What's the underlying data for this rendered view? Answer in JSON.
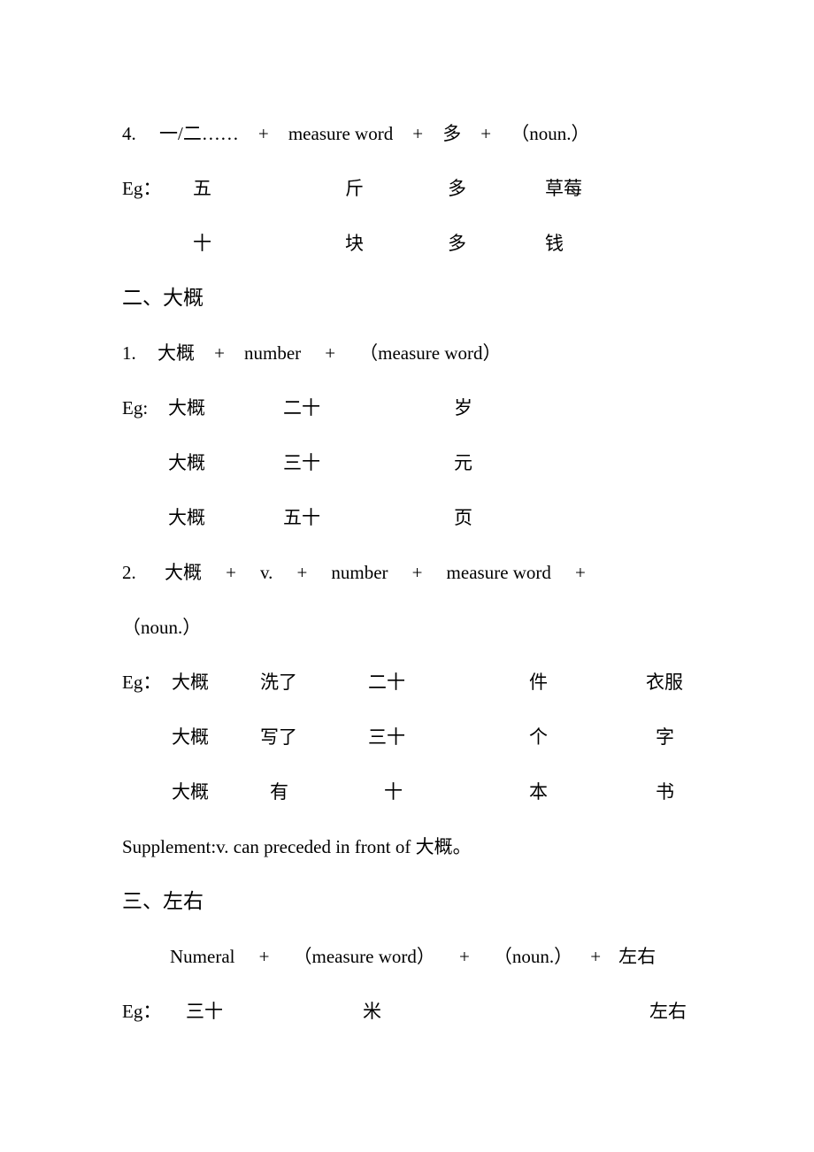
{
  "document": {
    "sections": [
      {
        "id": "section-one-tail",
        "items": [
          {
            "type": "pattern",
            "number": "4.",
            "tokens": [
              "一/二……",
              "+",
              "measure word",
              "+",
              "多",
              "+",
              "（noun.）"
            ]
          },
          {
            "type": "example",
            "label": "Eg：",
            "cells": [
              "五",
              "斤",
              "多",
              "草莓"
            ]
          },
          {
            "type": "example",
            "label": "",
            "cells": [
              "十",
              "块",
              "多",
              "钱"
            ]
          }
        ]
      },
      {
        "id": "section-two",
        "heading": "二、大概",
        "items": [
          {
            "type": "pattern",
            "number": "1.",
            "tokens": [
              "大概",
              "+",
              "number",
              "+",
              "（measure word）"
            ]
          },
          {
            "type": "example",
            "label": "Eg:",
            "cells": [
              "大概",
              "二十",
              "岁"
            ]
          },
          {
            "type": "example",
            "label": "",
            "cells": [
              "大概",
              "三十",
              "元"
            ]
          },
          {
            "type": "example",
            "label": "",
            "cells": [
              "大概",
              "五十",
              "页"
            ]
          },
          {
            "type": "pattern-wrap",
            "number": "2.",
            "tokens": [
              "大概",
              "+",
              "v.",
              "+",
              "number",
              "+",
              "measure word",
              "+"
            ],
            "continuation": "（noun.）"
          },
          {
            "type": "example",
            "label": "Eg：",
            "cells": [
              "大概",
              "洗了",
              "二十",
              "件",
              "衣服"
            ]
          },
          {
            "type": "example",
            "label": "",
            "cells": [
              "大概",
              "写了",
              "三十",
              "个",
              "字"
            ]
          },
          {
            "type": "example",
            "label": "",
            "cells": [
              "大概",
              "有",
              "十",
              "本",
              "书"
            ]
          },
          {
            "type": "supplement",
            "text": "Supplement:v. can preceded in front of 大概。"
          }
        ]
      },
      {
        "id": "section-three",
        "heading": "三、左右",
        "items": [
          {
            "type": "pattern-indent",
            "tokens": [
              "Numeral",
              "+",
              "（measure word）",
              "+",
              "（noun.）",
              "+",
              "左右"
            ]
          },
          {
            "type": "example",
            "label": "Eg：",
            "cells": [
              "三十",
              "米",
              "左右"
            ]
          }
        ]
      }
    ]
  }
}
